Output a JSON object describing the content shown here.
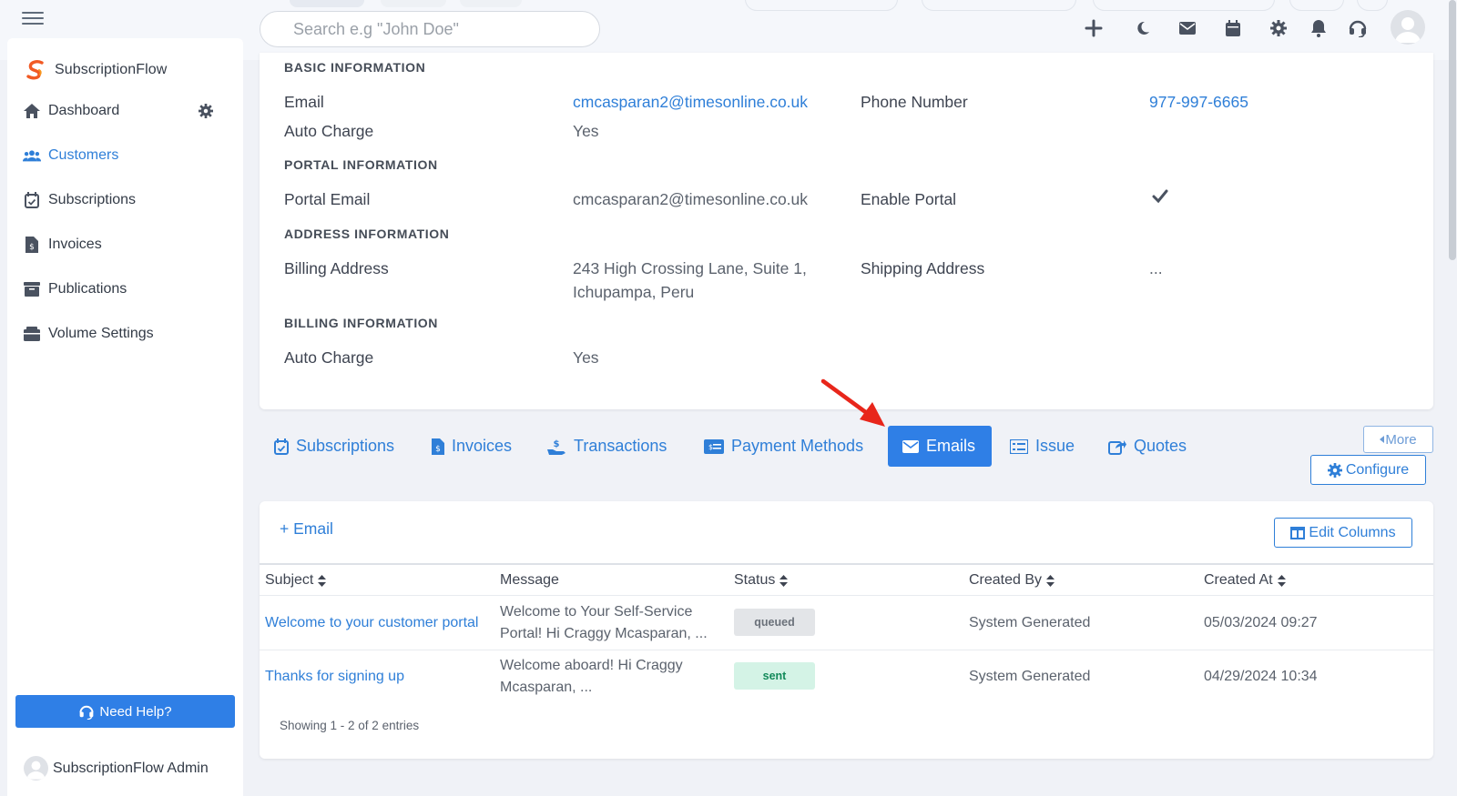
{
  "topbar": {
    "search_placeholder": "Search e.g \"John Doe\"",
    "icons": [
      "plus-icon",
      "moon-icon",
      "envelope-icon",
      "calendar-icon",
      "gear-icon",
      "bell-icon",
      "headset-icon",
      "user-avatar"
    ]
  },
  "sidebar": {
    "brand": "SubscriptionFlow",
    "items": [
      {
        "label": "Dashboard",
        "icon": "home-icon"
      },
      {
        "label": "Customers",
        "icon": "users-icon"
      },
      {
        "label": "Subscriptions",
        "icon": "calendar-check-icon"
      },
      {
        "label": "Invoices",
        "icon": "invoice-icon"
      },
      {
        "label": "Publications",
        "icon": "archive-icon"
      },
      {
        "label": "Volume Settings",
        "icon": "box-icon"
      }
    ],
    "active": "Customers",
    "help_label": "Need Help?",
    "admin_name": "SubscriptionFlow Admin"
  },
  "info": {
    "basic_head": "BASIC INFORMATION",
    "email_label": "Email",
    "email_value": "cmcasparan2@timesonline.co.uk",
    "phone_label": "Phone Number",
    "phone_value": "977-997-6665",
    "auto_charge_label": "Auto Charge",
    "auto_charge_value": "Yes",
    "portal_head": "PORTAL INFORMATION",
    "portal_email_label": "Portal Email",
    "portal_email_value": "cmcasparan2@timesonline.co.uk",
    "enable_portal_label": "Enable Portal",
    "address_head": "ADDRESS INFORMATION",
    "billing_address_label": "Billing Address",
    "billing_address_line1": "243 High Crossing Lane, Suite 1,",
    "billing_address_line2": "Ichupampa, Peru",
    "shipping_address_label": "Shipping Address",
    "shipping_address_value": "...",
    "billing_head": "BILLING INFORMATION",
    "billing_auto_charge_label": "Auto Charge",
    "billing_auto_charge_value": "Yes"
  },
  "tabs": [
    {
      "label": "Subscriptions",
      "icon": "calendar-check-icon"
    },
    {
      "label": "Invoices",
      "icon": "invoice-icon"
    },
    {
      "label": "Transactions",
      "icon": "hand-dollar-icon"
    },
    {
      "label": "Payment Methods",
      "icon": "credit-card-icon"
    },
    {
      "label": "Emails",
      "icon": "envelope-icon"
    },
    {
      "label": "Issue",
      "icon": "list-icon"
    },
    {
      "label": "Quotes",
      "icon": "share-icon"
    }
  ],
  "active_tab": "Emails",
  "more_label": "More",
  "configure_label": "Configure",
  "emails": {
    "add_label": "+ Email",
    "edit_columns_label": "Edit Columns",
    "columns": [
      "Subject",
      "Message",
      "Status",
      "Created By",
      "Created At"
    ],
    "rows": [
      {
        "subject": "Welcome to your customer portal",
        "message_line1": "Welcome to Your Self-Service",
        "message_line2": "Portal!  Hi Craggy Mcasparan, ...",
        "status": "queued",
        "created_by": "System Generated",
        "created_at": "05/03/2024 09:27"
      },
      {
        "subject": "Thanks for signing up",
        "message_line1": "Welcome aboard! Hi Craggy",
        "message_line2": "Mcasparan, ...",
        "status": "sent",
        "created_by": "System Generated",
        "created_at": "04/29/2024 10:34"
      }
    ],
    "showing": "Showing 1 - 2 of 2 entries"
  },
  "colors": {
    "accent": "#2f7fe6",
    "link": "#2f7fd8",
    "annotation_arrow": "#e8261b"
  }
}
